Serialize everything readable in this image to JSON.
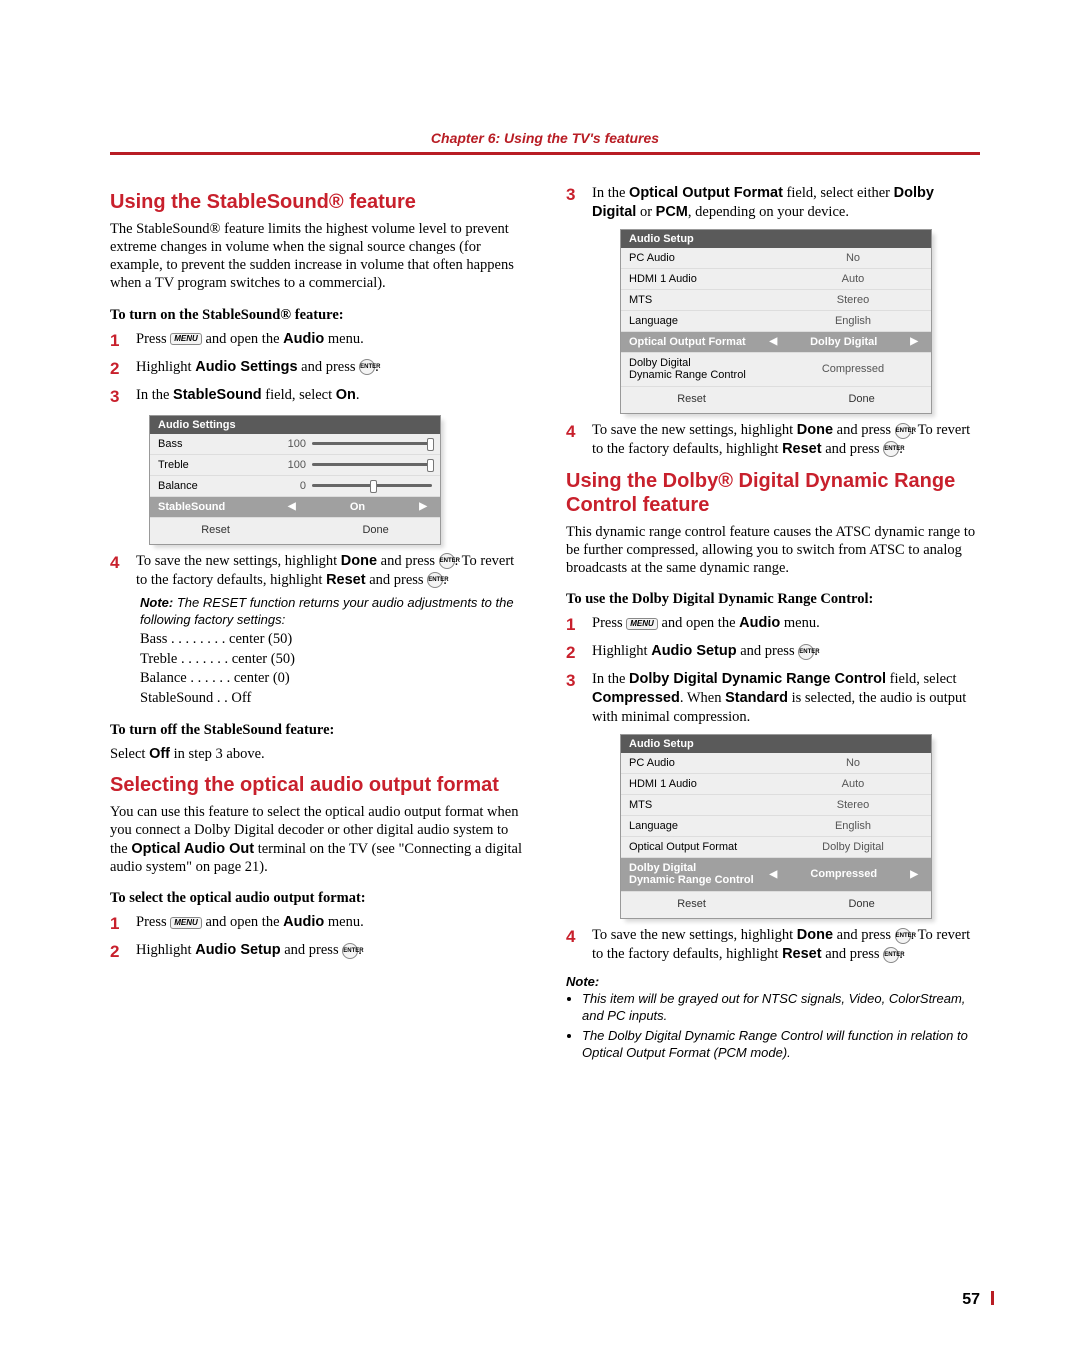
{
  "chapter": "Chapter 6: Using the TV's features",
  "page_number": "57",
  "left": {
    "h_stablesound": "Using the StableSound® feature",
    "p_stablesound": "The StableSound® feature limits the highest volume level to prevent extreme changes in volume when the signal source changes (for example, to prevent the sudden increase in volume that often happens when a TV program switches to a commercial).",
    "sub_on": "To turn on the StableSound® feature:",
    "steps_on": {
      "s1a": "Press ",
      "menu": "MENU",
      "s1b": " and open the ",
      "s1c": " menu.",
      "audio": "Audio",
      "s2a": "Highlight ",
      "s2b": " and press ",
      "audio_settings": "Audio Settings",
      "enter": "ENTER",
      "s3a": "In the ",
      "stablesound": "StableSound",
      "s3b": " field, select ",
      "on": "On",
      "s3c": "."
    },
    "osd_settings": {
      "title": "Audio Settings",
      "bass": "Bass",
      "bass_v": "100",
      "treble": "Treble",
      "treble_v": "100",
      "balance": "Balance",
      "balance_v": "0",
      "stable": "StableSound",
      "stable_v": "On",
      "reset": "Reset",
      "done": "Done"
    },
    "step4": {
      "a": "To save the new settings, highlight ",
      "done": "Done",
      "b": " and press ",
      "c": ". To revert to the factory defaults, highlight ",
      "reset": "Reset",
      "d": " and press ",
      "e": "."
    },
    "note_reset": "The RESET function returns your audio adjustments to the following factory settings:",
    "note_label": "Note:",
    "factory": {
      "bass": "Bass  . . . . . . . .  center (50)",
      "treble": "Treble  . . . . . . .  center (50)",
      "balance": "Balance  . . . . . .  center (0)",
      "stable": "StableSound  . .  Off"
    },
    "sub_off": "To turn off the StableSound feature:",
    "p_off_a": "Select ",
    "p_off_off": "Off",
    "p_off_b": " in step 3 above.",
    "h_optical": "Selecting the optical audio output format",
    "p_optical": "You can use this feature to select the optical audio output format when you connect a Dolby Digital decoder or other digital audio system to the ",
    "optical_out": "Optical Audio Out",
    "p_optical2": " terminal on the TV (see \"Connecting a digital audio system\" on page 21).",
    "sub_select": "To select the optical audio output format:",
    "opt_steps": {
      "s1a": "Press ",
      "s1b": " and open the ",
      "s1c": " menu.",
      "s2a": "Highlight ",
      "audio_setup": "Audio Setup",
      "s2b": " and press ",
      "s2c": "."
    }
  },
  "right": {
    "step3": {
      "a": "In the ",
      "oof": "Optical Output Format",
      "b": " field, select either ",
      "dd": "Dolby Digital",
      "c": " or ",
      "pcm": "PCM",
      "d": ", depending on your device."
    },
    "osd_setup1": {
      "title": "Audio Setup",
      "r1k": "PC Audio",
      "r1v": "No",
      "r2k": "HDMI 1 Audio",
      "r2v": "Auto",
      "r3k": "MTS",
      "r3v": "Stereo",
      "r4k": "Language",
      "r4v": "English",
      "r5k": "Optical Output Format",
      "r5v": "Dolby Digital",
      "r6k": "Dolby Digital\nDynamic Range Control",
      "r6v": "Compressed",
      "reset": "Reset",
      "done": "Done"
    },
    "step4r": {
      "a": "To save the new settings, highlight ",
      "done": "Done",
      "b": " and press ",
      "c": ". To revert to the factory defaults, highlight ",
      "reset": "Reset",
      "d": " and press ",
      "e": "."
    },
    "h_dolby": "Using the Dolby® Digital Dynamic Range Control feature",
    "p_dolby": "This dynamic range control feature causes the ATSC dynamic range to be further compressed, allowing you to switch from ATSC to analog broadcasts at the same dynamic range.",
    "sub_dolby": "To use the Dolby Digital Dynamic Range Control:",
    "dolby_steps": {
      "s1a": "Press ",
      "s1b": " and open the ",
      "s1c": " menu.",
      "s2a": "Highlight ",
      "s2b": " and press ",
      "s2c": ".",
      "s3a": "In the ",
      "ddrc": "Dolby Digital Dynamic Range Control",
      "s3b": " field, select ",
      "compressed": "Compressed",
      "s3c": ". When ",
      "standard": "Standard",
      "s3d": " is selected, the audio is output with minimal compression."
    },
    "osd_setup2": {
      "title": "Audio Setup",
      "r1k": "PC Audio",
      "r1v": "No",
      "r2k": "HDMI 1 Audio",
      "r2v": "Auto",
      "r3k": "MTS",
      "r3v": "Stereo",
      "r4k": "Language",
      "r4v": "English",
      "r5k": "Optical Output Format",
      "r5v": "Dolby Digital",
      "r6k": "Dolby Digital\nDynamic Range Control",
      "r6v": "Compressed",
      "reset": "Reset",
      "done": "Done"
    },
    "step4b": {
      "a": "To save the new settings, highlight ",
      "done": "Done",
      "b": " and press ",
      "c": ". To revert to the factory defaults, highlight ",
      "reset": "Reset",
      "d": " and press ",
      "e": "."
    },
    "note_hdr": "Note:",
    "note_items": {
      "n1": "This item will be grayed out for NTSC signals, Video, ColorStream, and PC inputs.",
      "n2": "The Dolby Digital Dynamic Range Control will function in relation to Optical Output Format (PCM mode)."
    }
  }
}
